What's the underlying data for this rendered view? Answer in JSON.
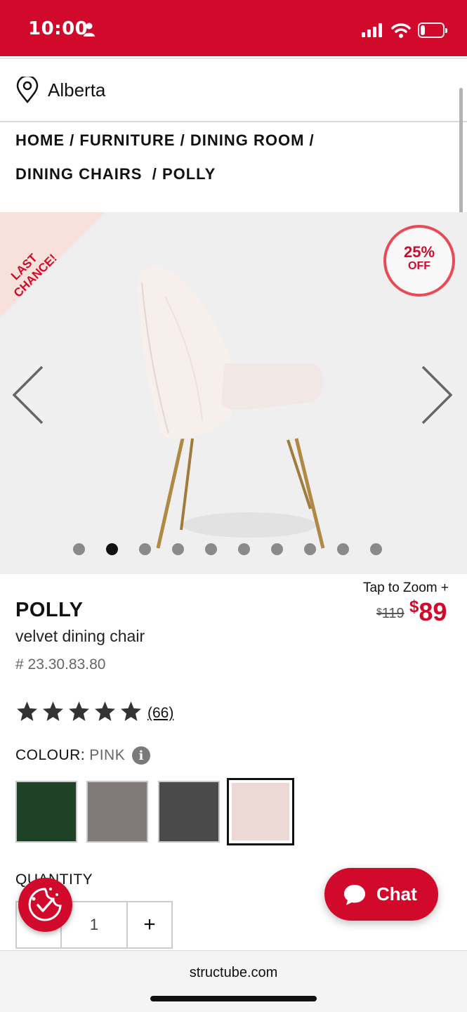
{
  "status_bar": {
    "time": "10:00",
    "battery": "21",
    "battery_level": 0.21
  },
  "location": {
    "label": "Alberta"
  },
  "breadcrumb": {
    "items": [
      "HOME",
      "FURNITURE",
      "DINING ROOM",
      "DINING CHAIRS",
      "POLLY"
    ],
    "separator": "/"
  },
  "hero": {
    "badge": "LAST CHANCE!",
    "discount_pct": "25%",
    "discount_off": "OFF",
    "image_count": 10,
    "active_image": 2
  },
  "product": {
    "tap_to_zoom": "Tap to Zoom +",
    "price_old_currency": "$",
    "price_old": "119",
    "price_new_currency": "$",
    "price_new": "89",
    "name": "POLLY",
    "subtitle": "velvet dining chair",
    "sku": "# 23.30.83.80",
    "rating": 5,
    "reviews": "(66)",
    "colour_label": "COLOUR:",
    "colour_value": "PINK",
    "info_icon": "i",
    "swatches": [
      {
        "color": "#1f4226"
      },
      {
        "color": "#827a78"
      },
      {
        "color": "#4a4a4a"
      },
      {
        "color": "#ecd9d6",
        "selected": true
      }
    ],
    "quantity_label": "QUANTITY",
    "quantity": "1",
    "plus": "+"
  },
  "chat": {
    "label": "Chat"
  },
  "browser": {
    "url": "structube.com"
  },
  "colors": {
    "brand_red": "#d10a2b",
    "badge_bg": "#f7e1da"
  },
  "icons": [
    "person-icon",
    "signal-icon",
    "wifi-icon",
    "battery-icon",
    "location-pin-icon",
    "chevron-left-icon",
    "chevron-right-icon",
    "star-icon",
    "info-icon",
    "cookie-icon",
    "chat-bubble-icon"
  ]
}
